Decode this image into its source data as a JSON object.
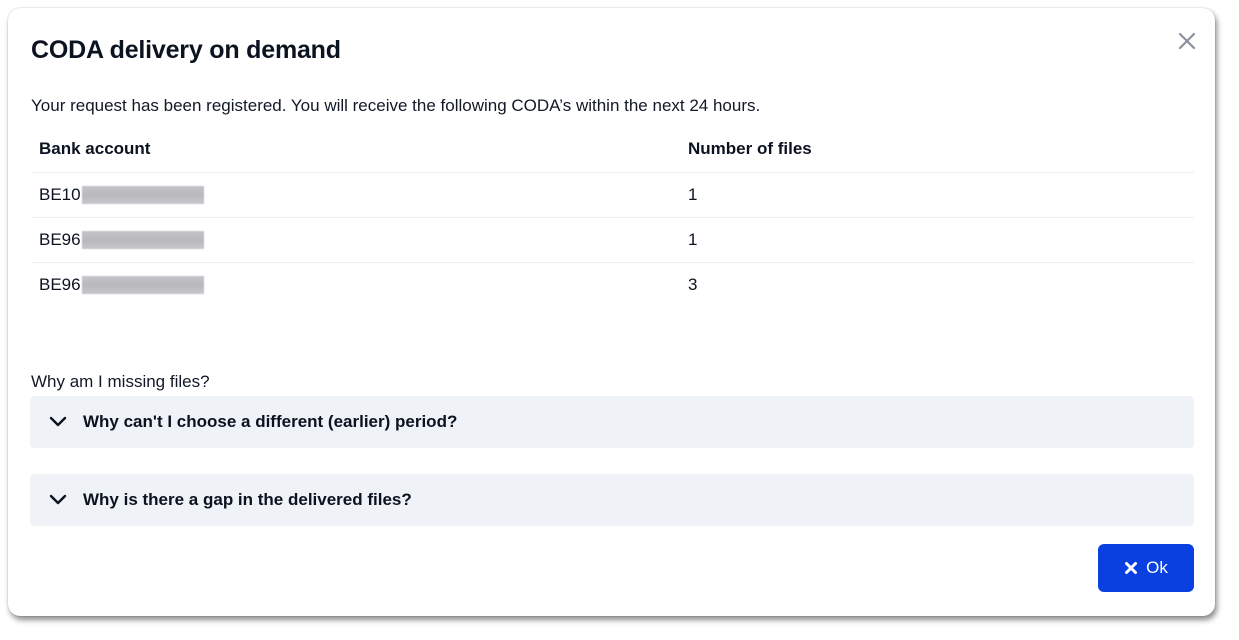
{
  "dialog": {
    "title": "CODA delivery on demand",
    "intro": "Your request has been registered. You will receive the following CODA’s within the next 24 hours.",
    "close_icon": "close-icon"
  },
  "table": {
    "headers": {
      "account": "Bank account",
      "files": "Number of files"
    },
    "rows": [
      {
        "account_prefix": "BE10",
        "files": "1"
      },
      {
        "account_prefix": "BE96",
        "files": "1"
      },
      {
        "account_prefix": "BE96",
        "files": "3"
      }
    ]
  },
  "faq": {
    "section_label": "Why am I missing files?",
    "items": [
      {
        "question": "Why can't I choose a different (earlier) period?",
        "icon": "chevron-down-icon"
      },
      {
        "question": "Why is there a gap in the delivered files?",
        "icon": "chevron-down-icon"
      }
    ]
  },
  "actions": {
    "ok_label": "Ok",
    "ok_icon": "times-icon"
  },
  "colors": {
    "primary": "#0a3fe0",
    "faq_background": "#eff2f7",
    "text": "#0b1220"
  }
}
